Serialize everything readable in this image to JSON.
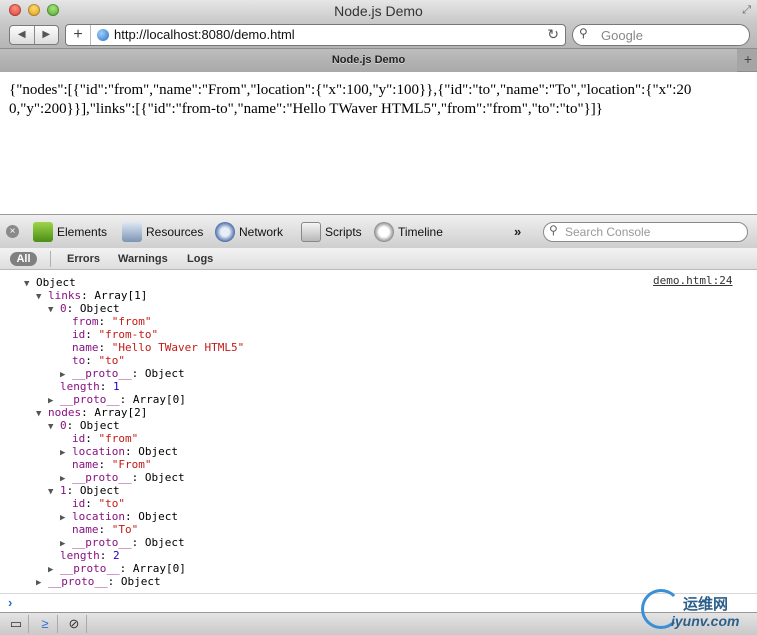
{
  "window": {
    "title": "Node.js Demo"
  },
  "toolbar": {
    "back_icon": "back-arrow-icon",
    "forward_icon": "forward-arrow-icon",
    "address": "http://localhost:8080/demo.html",
    "search_placeholder": "Google"
  },
  "tabs": [
    {
      "label": "Node.js Demo"
    }
  ],
  "page": {
    "body_text": "{\"nodes\":[{\"id\":\"from\",\"name\":\"From\",\"location\":{\"x\":100,\"y\":100}},{\"id\":\"to\",\"name\":\"To\",\"location\":{\"x\":200,\"y\":200}}],\"links\":[{\"id\":\"from-to\",\"name\":\"Hello TWaver HTML5\",\"from\":\"from\",\"to\":\"to\"}]}"
  },
  "devtools": {
    "tabs": [
      {
        "label": "Elements",
        "icon": "elements-icon"
      },
      {
        "label": "Resources",
        "icon": "resources-icon"
      },
      {
        "label": "Network",
        "icon": "network-icon"
      },
      {
        "label": "Scripts",
        "icon": "scripts-icon"
      },
      {
        "label": "Timeline",
        "icon": "timeline-icon"
      }
    ],
    "more": "»",
    "search_placeholder": "Search Console",
    "filters": {
      "all": "All",
      "errors": "Errors",
      "warnings": "Warnings",
      "logs": "Logs"
    }
  },
  "console": {
    "source_link": "demo.html:24",
    "tree": {
      "root": "Object",
      "links_key": "links",
      "links_val": "Array[1]",
      "links0_key": "0",
      "links0_val": "Object",
      "from_key": "from",
      "from_val": "\"from\"",
      "id_key": "id",
      "id_val": "\"from-to\"",
      "name_key": "name",
      "name_val": "\"Hello TWaver HTML5\"",
      "to_key": "to",
      "to_val": "\"to\"",
      "proto_key": "__proto__",
      "proto_obj": "Object",
      "proto_arr": "Array[0]",
      "length_key": "length",
      "links_length": "1",
      "nodes_key": "nodes",
      "nodes_val": "Array[2]",
      "n0_key": "0",
      "n0_val": "Object",
      "n0_id": "\"from\"",
      "location_key": "location",
      "location_val": "Object",
      "n0_name": "\"From\"",
      "n1_key": "1",
      "n1_val": "Object",
      "n1_id": "\"to\"",
      "n1_name": "\"To\"",
      "nodes_length": "2"
    },
    "prompt": "›"
  },
  "watermark": {
    "cn": "运维网",
    "en": "iyunv.com"
  }
}
